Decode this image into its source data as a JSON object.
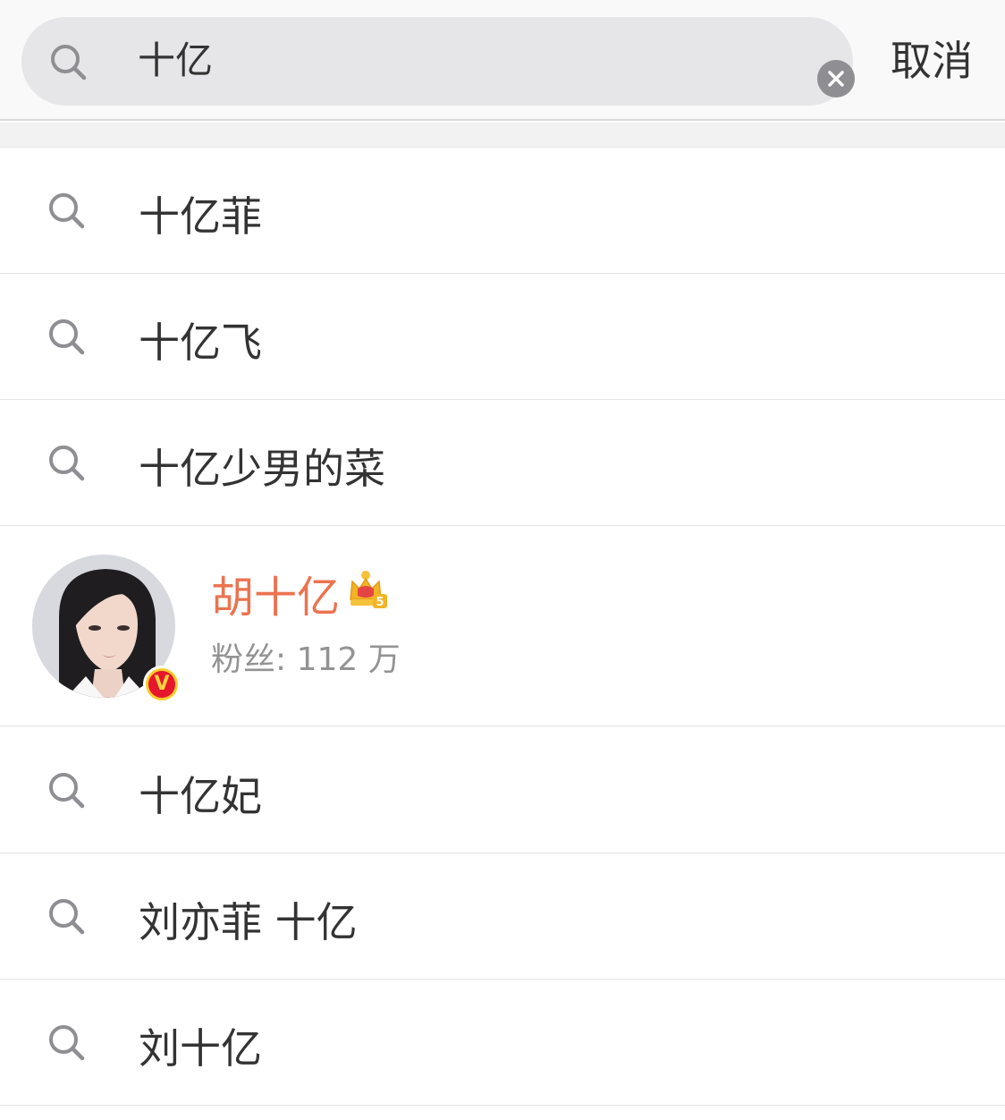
{
  "search": {
    "query": "十亿",
    "icon": "search-icon",
    "clear_icon": "clear-icon",
    "cancel_label": "取消"
  },
  "suggestions_top": [
    {
      "text": "十亿菲",
      "icon": "search-icon"
    },
    {
      "text": "十亿飞",
      "icon": "search-icon"
    },
    {
      "text": "十亿少男的菜",
      "icon": "search-icon"
    }
  ],
  "user_result": {
    "name": "胡十亿",
    "crown_level": "5",
    "verify_mark": "V",
    "fans_label": "粉丝: 112 万",
    "name_color": "#eb7350"
  },
  "suggestions_bottom": [
    {
      "text": "十亿妃",
      "icon": "search-icon"
    },
    {
      "text": "刘亦菲 十亿",
      "icon": "search-icon"
    },
    {
      "text": "刘十亿",
      "icon": "search-icon"
    }
  ],
  "colors": {
    "accent_orange": "#eb7350",
    "verify_red": "#e6162d",
    "verify_gold": "#ffcb2e"
  }
}
